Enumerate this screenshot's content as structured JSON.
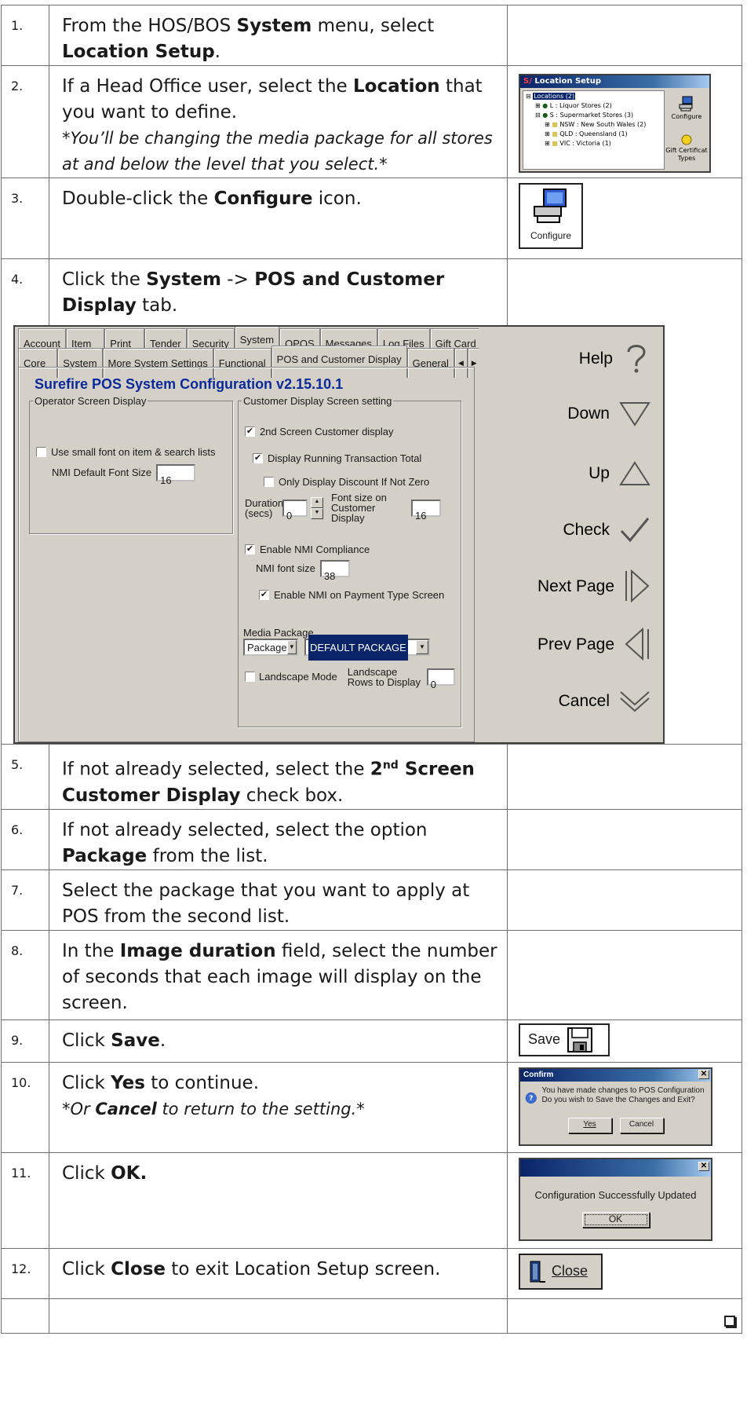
{
  "steps": [
    {
      "num": "1.",
      "parts": [
        "From the HOS/BOS ",
        "System",
        " menu, select ",
        "Location Setup",
        "."
      ]
    },
    {
      "num": "2.",
      "parts": [
        "If a Head Office user, select the ",
        "Location",
        " that you want to define."
      ],
      "note": "*You’ll be changing the media package for all stores at and below the level that you select.*"
    },
    {
      "num": "3.",
      "parts": [
        "Double-click the ",
        "Configure",
        " icon."
      ]
    },
    {
      "num": "4.",
      "parts": [
        "Click the ",
        "System",
        " -> ",
        "POS and Customer Display",
        " tab."
      ]
    },
    {
      "num": "5.",
      "parts": [
        "If not already selected, select the ",
        "2",
        "nd",
        " Screen Customer Display",
        " check box."
      ]
    },
    {
      "num": "6.",
      "parts": [
        "If not already selected, select the option ",
        "Package",
        " from the list."
      ]
    },
    {
      "num": "7.",
      "parts": [
        "Select the package that you want to apply at POS from the second list."
      ]
    },
    {
      "num": "8.",
      "parts": [
        "In the ",
        "Image duration",
        " field, select the number of seconds that each image will display on the screen."
      ]
    },
    {
      "num": "9.",
      "parts": [
        "Click ",
        "Save",
        "."
      ]
    },
    {
      "num": "10.",
      "parts": [
        "Click ",
        "Yes",
        " to continue."
      ],
      "note_pre": "*Or ",
      "note_bold": "Cancel",
      "note_post": " to return to the setting.*"
    },
    {
      "num": "11.",
      "parts": [
        "Click ",
        "OK."
      ]
    },
    {
      "num": "12.",
      "parts": [
        "Click ",
        "Close",
        " to exit Location Setup screen."
      ]
    }
  ],
  "location_setup": {
    "title": "Location Setup",
    "tree": [
      "Locations (2)",
      "L : Liquor Stores (2)",
      "S : Supermarket Stores (3)",
      "NSW : New South Wales (2)",
      "QLD : Queensland (1)",
      "VIC : Victoria (1)"
    ],
    "configure_label": "Configure",
    "gift_label": "Gift Certificat Types"
  },
  "configure_icon_label": "Configure",
  "config_screen": {
    "tabs_top": [
      "Account",
      "Item",
      "Print",
      "Tender",
      "Security",
      "System",
      "OPOS",
      "Messages",
      "Log Files",
      "Gift Card"
    ],
    "tabs_second": [
      "Core",
      "System",
      "More System Settings",
      "Functional",
      "POS and Customer Display",
      "General"
    ],
    "title": "Surefire POS System Configuration v2.15.10.1",
    "operator_group": "Operator Screen Display",
    "small_font_label": "Use small font on item & search lists",
    "nmi_default_font_label": "NMI Default Font Size",
    "nmi_default_font_value": "16",
    "customer_group": "Customer Display Screen setting",
    "second_screen_label": "2nd Screen Customer display",
    "running_total_label": "Display Running Transaction Total",
    "discount_label": "Only Display Discount If Not Zero",
    "duration_label": "Duration (secs)",
    "duration_value": "0",
    "font_size_label": "Font size on Customer Display",
    "font_size_value": "16",
    "nmi_compliance_label": "Enable NMI Compliance",
    "nmi_font_label": "NMI font size",
    "nmi_font_value": "38",
    "nmi_payment_label": "Enable NMI on Payment Type Screen",
    "media_package_label": "Media Package",
    "package_select": "Package",
    "default_package": "DEFAULT PACKAGE",
    "landscape_label": "Landscape Mode",
    "landscape_rows_label": "Landscape Rows to Display",
    "landscape_rows_value": "0",
    "side_buttons": [
      "Help",
      "Down",
      "Up",
      "Check",
      "Next Page",
      "Prev Page",
      "Cancel"
    ]
  },
  "save_label": "Save",
  "confirm": {
    "title": "Confirm",
    "message": "You have made changes to POS Configuration Do you wish to Save the Changes and Exit?",
    "yes": "Yes",
    "cancel": "Cancel"
  },
  "success": {
    "message": "Configuration Successfully Updated",
    "ok": "OK"
  },
  "close_label": "Close",
  "colors": {
    "accent_blue": "#0a2a9a",
    "title_bar": "#0a246a",
    "dialog_gray": "#d4d0c8"
  }
}
